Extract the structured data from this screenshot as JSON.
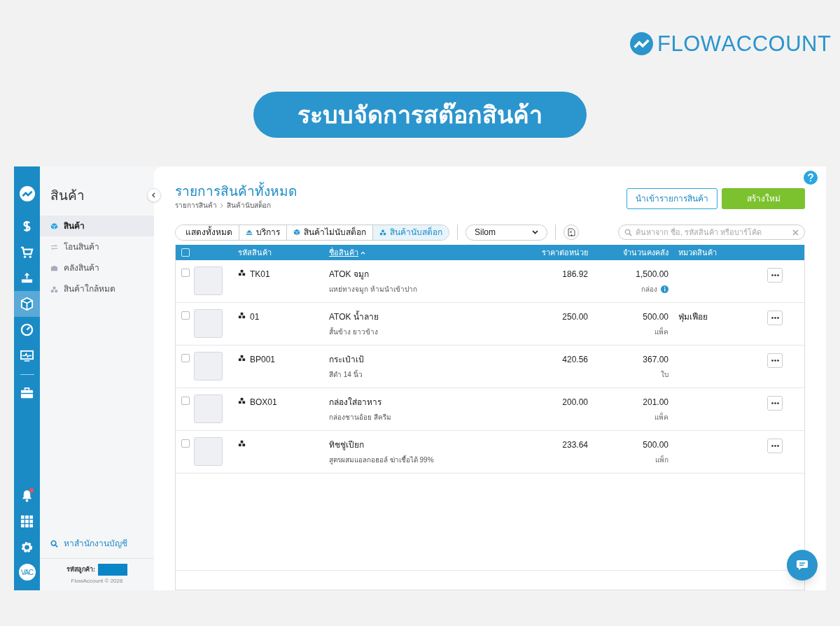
{
  "logo": {
    "text": "**FLOW**ACCOUNT"
  },
  "banner": {
    "title": "ระบบจัดการสต๊อกสินค้า"
  },
  "rail": {
    "items": [
      {
        "selected": false
      },
      {
        "selected": false
      },
      {
        "selected": false
      },
      {
        "selected": false
      },
      {
        "selected": true
      },
      {
        "selected": false
      },
      {
        "selected": false
      },
      {
        "selected": false
      }
    ],
    "bottom": [
      {
        "badge": true
      },
      {
        "badge": false
      },
      {
        "badge": false
      }
    ],
    "avatar": "VAC"
  },
  "sidebar": {
    "title": "สินค้า",
    "items": [
      {
        "label": "สินค้า",
        "selected": true
      },
      {
        "label": "โอนสินค้า",
        "selected": false
      },
      {
        "label": "คลังสินค้า",
        "selected": false
      },
      {
        "label": "สินค้าใกล้หมด",
        "selected": false
      }
    ],
    "find_link": "หาสำนักงานบัญชี",
    "customer_label": "รหัสลูกค้า:",
    "copyright": "FlowAccount © 2026"
  },
  "main": {
    "title": "รายการสินค้าทั้งหมด",
    "breadcrumb": [
      "รายการสินค้า",
      "สินค้านับสต็อก"
    ],
    "import_button": "นำเข้ารายการสินค้า",
    "create_button": "สร้างใหม่",
    "filters": [
      {
        "label": "แสดงทั้งหมด",
        "selected": false
      },
      {
        "label": "บริการ",
        "selected": false
      },
      {
        "label": "สินค้าไม่นับสต็อก",
        "selected": false
      },
      {
        "label": "สินค้านับสต็อก",
        "selected": true
      }
    ],
    "branch": "Silom",
    "search_placeholder": "ค้นหาจาก ชื่อ, รหัสสินค้า หรือบาร์โค้ด",
    "table": {
      "all_checked": false,
      "columns": [
        {
          "label": "รหัสสินค้า",
          "sorted": false
        },
        {
          "label": "ชื่อสินค้า",
          "sorted": true
        },
        {
          "label": "ราคาต่อหน่วย",
          "sorted": false
        },
        {
          "label": "จำนวนคงคลัง",
          "sorted": false
        },
        {
          "label": "หมวดสินค้า",
          "sorted": false
        }
      ],
      "rows": [
        {
          "checked": false,
          "code": "TK01",
          "name": "ATOK จมูก",
          "description": "แหย่ทางจมูก ห้ามนำเข้าปาก",
          "price": "186.92",
          "quantity": "1,500.00",
          "unit": "กล่อง",
          "info": true
        },
        {
          "checked": false,
          "code": "01",
          "name": "ATOK น้ำลาย",
          "description": "สั้นข้าง ยาวข้าง",
          "price": "250.00",
          "quantity": "500.00",
          "unit": "แพ็ค",
          "info": false,
          "category": "ฟุ่มเฟือย"
        },
        {
          "checked": false,
          "code": "BP001",
          "name": "กระเป๋าเป้",
          "description": "สีดำ 14 นิ้ว",
          "price": "420.56",
          "quantity": "367.00",
          "unit": "ใบ",
          "info": false
        },
        {
          "checked": false,
          "code": "BOX01",
          "name": "กล่องใส่อาหาร",
          "description": "กล่องชานอ้อย สีครีม",
          "price": "200.00",
          "quantity": "201.00",
          "unit": "แพ็ค",
          "info": false
        },
        {
          "checked": false,
          "name": "ทิชชู่เปียก",
          "description": "สูตรผสมแอลกอฮอล์ ฆ่าเชื้อได้ 99%",
          "price": "233.64",
          "quantity": "500.00",
          "unit": "แพ็ก",
          "info": false
        }
      ]
    }
  }
}
